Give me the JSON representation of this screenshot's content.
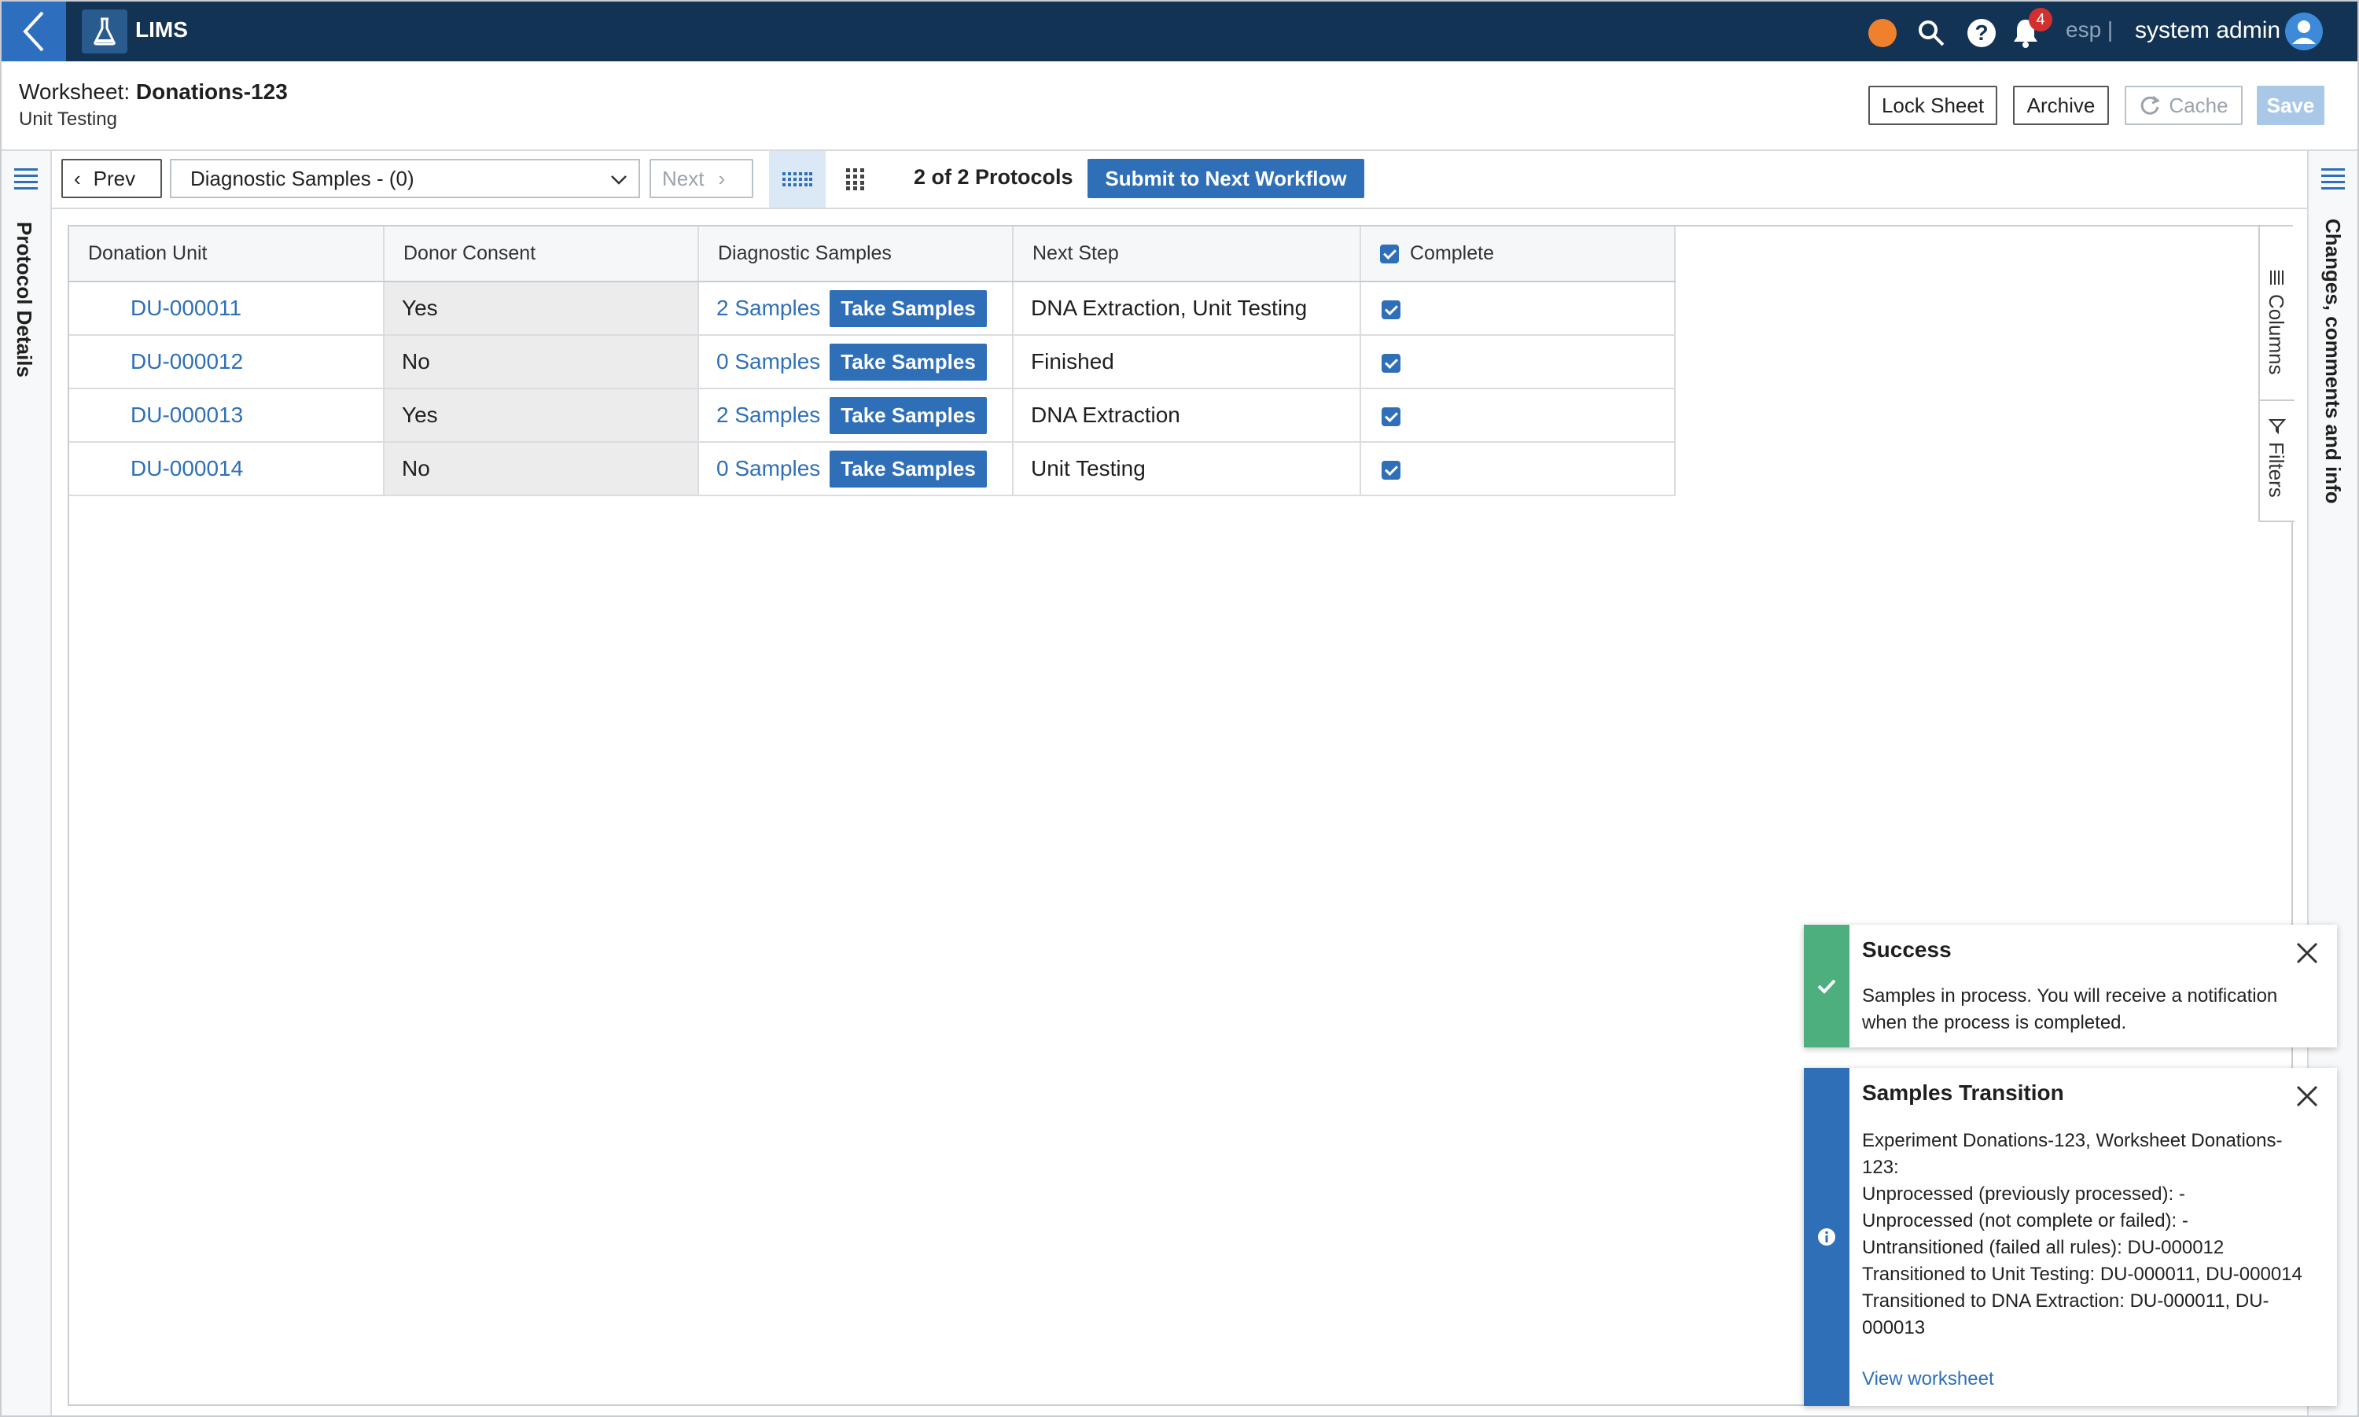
{
  "app": {
    "name": "LIMS",
    "tenant": "esp |",
    "user": "system admin",
    "notification_count": "4"
  },
  "header": {
    "worksheet_label": "Worksheet:",
    "worksheet_name": "Donations-123",
    "subtitle": "Unit Testing",
    "buttons": {
      "lock": "Lock Sheet",
      "archive": "Archive",
      "cache": "Cache",
      "save": "Save"
    }
  },
  "toolbar": {
    "prev": "Prev",
    "protocol": "Diagnostic Samples - (0)",
    "next": "Next",
    "protocol_count": "2 of 2 Protocols",
    "submit": "Submit to Next Workflow"
  },
  "left_panel": {
    "label": "Protocol Details"
  },
  "right_panel": {
    "label": "Changes, comments and info"
  },
  "grid_tools": {
    "columns": "Columns",
    "filters": "Filters"
  },
  "table": {
    "headers": [
      "Donation Unit",
      "Donor Consent",
      "Diagnostic Samples",
      "Next Step",
      "Complete"
    ],
    "take_label": "Take Samples",
    "rows": [
      {
        "unit": "DU-000011",
        "consent": "Yes",
        "samples": "2 Samples",
        "next": "DNA Extraction, Unit Testing",
        "complete": true
      },
      {
        "unit": "DU-000012",
        "consent": "No",
        "samples": "0 Samples",
        "next": "Finished",
        "complete": true
      },
      {
        "unit": "DU-000013",
        "consent": "Yes",
        "samples": "2 Samples",
        "next": "DNA Extraction",
        "complete": true
      },
      {
        "unit": "DU-000014",
        "consent": "No",
        "samples": "0 Samples",
        "next": "Unit Testing",
        "complete": true
      }
    ]
  },
  "toasts": {
    "success": {
      "title": "Success",
      "lines": [
        "Samples in process. You will receive a notification",
        "when the process is completed."
      ],
      "color": "#4caf7d"
    },
    "transition": {
      "title": "Samples Transition",
      "lines": [
        "Experiment Donations-123, Worksheet Donations-",
        "123:",
        "Unprocessed (previously processed): -",
        "Unprocessed (not complete or failed): -",
        "Untransitioned (failed all rules): DU-000012",
        "Transitioned to Unit Testing: DU-000011, DU-000014",
        "Transitioned to DNA Extraction: DU-000011, DU-",
        "000013"
      ],
      "link": "View worksheet",
      "color": "#2f6fb8"
    }
  },
  "colors": {
    "topbar": "#123354",
    "accent": "#2f6fb8",
    "status_dot": "#f0812c",
    "badge": "#d32f2f"
  }
}
